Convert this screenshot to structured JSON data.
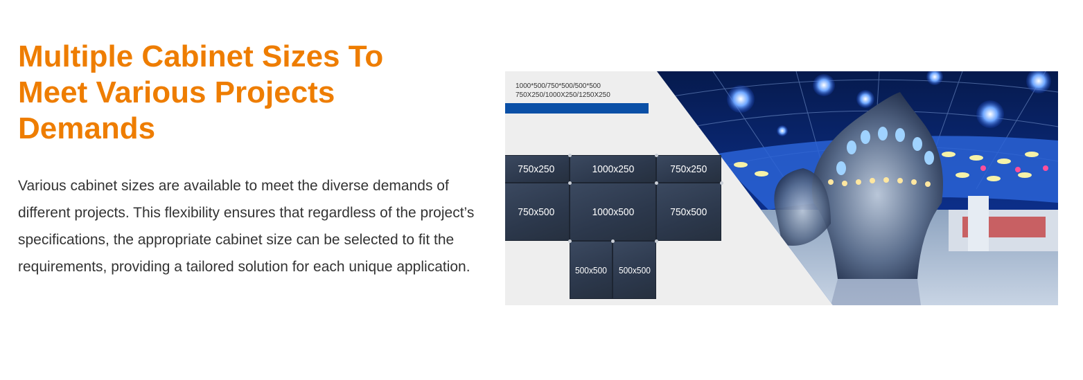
{
  "heading": {
    "line1": "Multiple Cabinet Sizes To",
    "line2": "Meet Various Projects",
    "line3": "Demands"
  },
  "description": "Various cabinet sizes are available to meet the diverse demands of different projects. This flexibility ensures that regardless of the project’s specifications, the appropriate cabinet size can be selected to fit the requirements, providing a tailored solution for each unique application.",
  "banner": {
    "spec_line1": "1000*500/750*500/500*500",
    "spec_line2": "750X250/1000X250/1250X250",
    "accent_color": "#0a4fa6",
    "panels": {
      "p1": "750x250",
      "p2": "1000x250",
      "p3": "750x250",
      "p4": "750x500",
      "p5": "1000x500",
      "p6": "750x500",
      "p7": "500x500",
      "p8": "500x500"
    }
  },
  "colors": {
    "heading": "#ee7d00",
    "body_text": "#333333"
  }
}
